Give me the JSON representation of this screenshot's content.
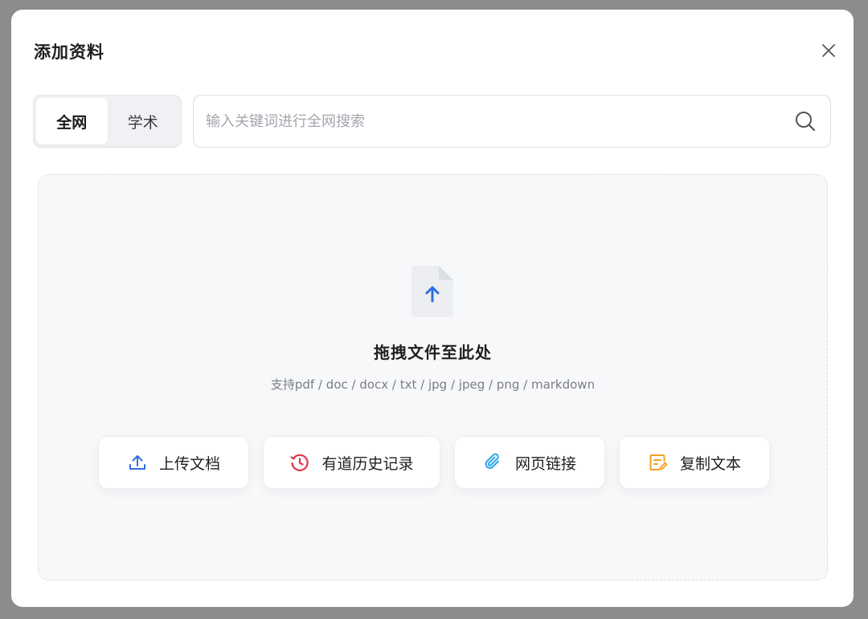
{
  "dialog": {
    "title": "添加资料",
    "close_icon": "close-icon"
  },
  "tabs": [
    {
      "label": "全网",
      "active": true
    },
    {
      "label": "学术",
      "active": false
    }
  ],
  "search": {
    "placeholder": "输入关键词进行全网搜索",
    "value": "",
    "icon": "search-icon"
  },
  "dropzone": {
    "icon": "file-upload-icon",
    "title": "拖拽文件至此处",
    "subtitle": "支持pdf / doc / docx / txt / jpg / jpeg / png / markdown"
  },
  "actions": [
    {
      "label": "上传文档",
      "icon": "upload-icon",
      "color": "#2f6fe4"
    },
    {
      "label": "有道历史记录",
      "icon": "history-icon",
      "color": "#e2334a"
    },
    {
      "label": "网页链接",
      "icon": "paperclip-icon",
      "color": "#34a7e6"
    },
    {
      "label": "复制文本",
      "icon": "edit-note-icon",
      "color": "#f0a020"
    }
  ],
  "colors": {
    "accent": "#2f6fe4",
    "overlay": "#8c8c8e"
  }
}
